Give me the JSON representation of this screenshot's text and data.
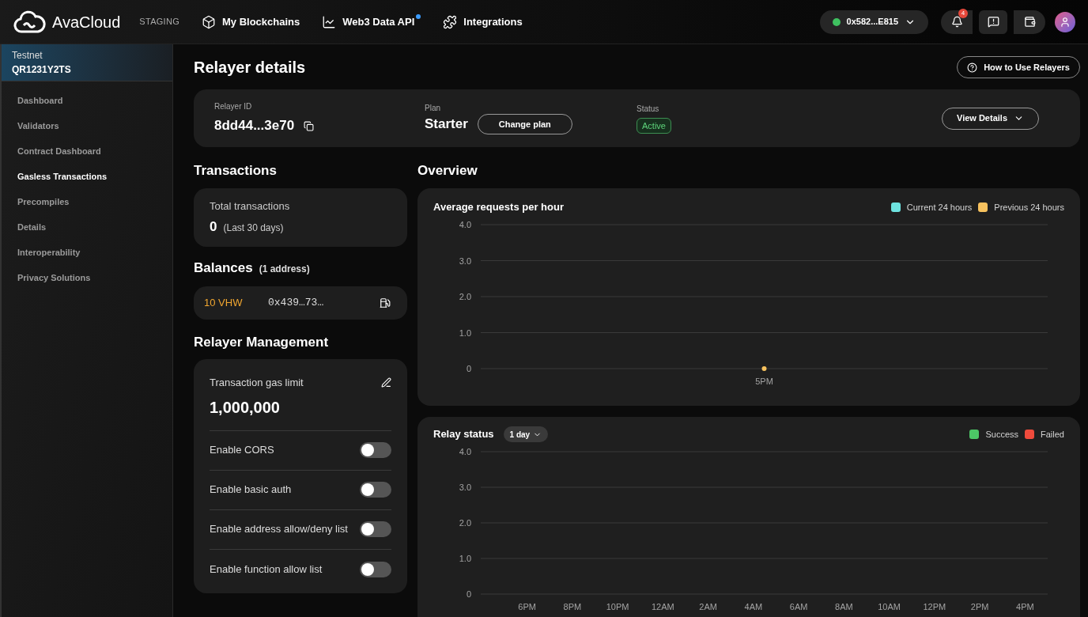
{
  "header": {
    "brand": "AvaCloud",
    "env": "STAGING",
    "nav": [
      {
        "label": "My Blockchains",
        "dot": false
      },
      {
        "label": "Web3 Data API",
        "dot": true
      },
      {
        "label": "Integrations",
        "dot": false
      }
    ],
    "wallet": {
      "address": "0x582...E815",
      "connected": true
    },
    "notifications": "4"
  },
  "sidebar": {
    "network": "Testnet",
    "chain_id": "QR1231Y2TS",
    "items": [
      {
        "label": "Dashboard",
        "selected": false
      },
      {
        "label": "Validators",
        "selected": false
      },
      {
        "label": "Contract Dashboard",
        "selected": false
      },
      {
        "label": "Gasless Transactions",
        "selected": true
      },
      {
        "label": "Precompiles",
        "selected": false
      },
      {
        "label": "Details",
        "selected": false
      },
      {
        "label": "Interoperability",
        "selected": false
      },
      {
        "label": "Privacy Solutions",
        "selected": false
      }
    ]
  },
  "page": {
    "title": "Relayer details",
    "help_button": "How to Use Relayers"
  },
  "summary": {
    "id_label": "Relayer ID",
    "id": "8dd44...3e70",
    "plan_label": "Plan",
    "plan": "Starter",
    "change_plan": "Change plan",
    "status_label": "Status",
    "status": "Active",
    "details_button": "View Details"
  },
  "transactions": {
    "title": "Transactions",
    "label": "Total transactions",
    "count": "0",
    "period": "(Last 30 days)"
  },
  "balances": {
    "title": "Balances",
    "note": "(1 address)",
    "rows": [
      {
        "amount": "10 VHW",
        "address": "0x439…73…"
      }
    ]
  },
  "management": {
    "title": "Relayer Management",
    "gas_label": "Transaction gas limit",
    "gas_value": "1,000,000",
    "toggles": [
      {
        "label": "Enable CORS",
        "on": false
      },
      {
        "label": "Enable basic auth",
        "on": false
      },
      {
        "label": "Enable address allow/deny list",
        "on": false
      },
      {
        "label": "Enable function allow list",
        "on": false
      }
    ]
  },
  "overview": {
    "title": "Overview",
    "requests": {
      "title": "Average requests per hour",
      "chart_data": {
        "type": "line",
        "categories": [
          "5PM"
        ],
        "series": [
          {
            "name": "Current 24 hours",
            "color": "#6ee3e0",
            "values": [
              null
            ]
          },
          {
            "name": "Previous 24 hours",
            "color": "#f7c25e",
            "values": [
              0
            ],
            "marker": true
          }
        ],
        "grid": true,
        "ylim": [
          0,
          4
        ],
        "yticks": [
          {
            "value": 0,
            "label": "0"
          },
          {
            "value": 1,
            "label": "1.0"
          },
          {
            "value": 2,
            "label": "2.0"
          },
          {
            "value": 3,
            "label": "3.0"
          },
          {
            "value": 4,
            "label": "4.0"
          }
        ]
      }
    },
    "relay": {
      "title": "Relay status",
      "range": "1 day",
      "chart_data": {
        "type": "bar",
        "categories": [
          "6PM",
          "8PM",
          "10PM",
          "12AM",
          "2AM",
          "4AM",
          "6AM",
          "8AM",
          "10AM",
          "12PM",
          "2PM",
          "4PM"
        ],
        "series": [
          {
            "name": "Success",
            "color": "#4cc766",
            "values": [
              0,
              0,
              0,
              0,
              0,
              0,
              0,
              0,
              0,
              0,
              0,
              0
            ]
          },
          {
            "name": "Failed",
            "color": "#ef4b3c",
            "values": [
              0,
              0,
              0,
              0,
              0,
              0,
              0,
              0,
              0,
              0,
              0,
              0
            ]
          }
        ],
        "grid": true,
        "ylim": [
          0,
          4
        ],
        "yticks": [
          {
            "value": 0,
            "label": "0"
          },
          {
            "value": 1,
            "label": "1.0"
          },
          {
            "value": 2,
            "label": "2.0"
          },
          {
            "value": 3,
            "label": "3.0"
          },
          {
            "value": 4,
            "label": "4.0"
          }
        ]
      }
    }
  }
}
